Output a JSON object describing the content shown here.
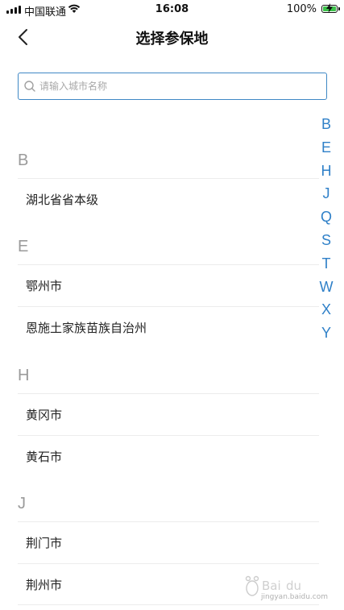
{
  "status_bar": {
    "carrier": "中国联通",
    "time": "16:08",
    "battery": "100%",
    "battery_level": 1.0
  },
  "nav": {
    "title": "选择参保地",
    "back_icon": "chevron-left-icon"
  },
  "search": {
    "placeholder": "请输入城市名称",
    "value": "",
    "icon": "search-icon"
  },
  "sections": [
    {
      "letter": "B",
      "items": [
        "湖北省省本级"
      ]
    },
    {
      "letter": "E",
      "items": [
        "鄂州市",
        "恩施土家族苗族自治州"
      ]
    },
    {
      "letter": "H",
      "items": [
        "黄冈市",
        "黄石市"
      ]
    },
    {
      "letter": "J",
      "items": [
        "荆门市",
        "荆州市"
      ]
    }
  ],
  "index_letters": [
    "B",
    "E",
    "H",
    "J",
    "Q",
    "S",
    "T",
    "W",
    "X",
    "Y"
  ],
  "watermark": {
    "brand": "Baidu经验",
    "url": "jingyan.baidu.com"
  },
  "colors": {
    "accent": "#2f80c8",
    "search_border": "#3f88c5",
    "section_letter": "#9a9a9a",
    "battery": "#3cc24a"
  }
}
